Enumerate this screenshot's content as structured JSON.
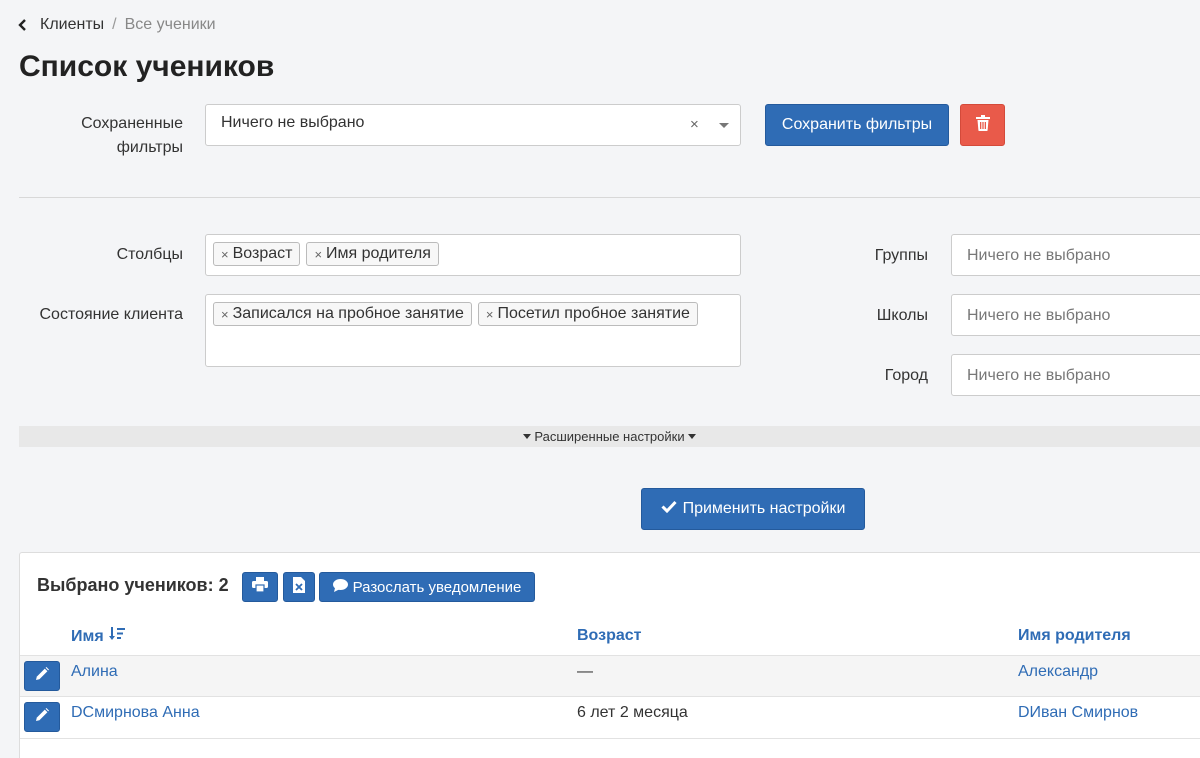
{
  "breadcrumb": {
    "parent": "Клиенты",
    "separator": "/",
    "current": "Все ученики"
  },
  "page_title": "Список учеников",
  "saved_filters": {
    "label_line1": "Сохраненные",
    "label_line2": "фильтры",
    "value": "Ничего не выбрано",
    "clear_symbol": "×",
    "save_button": "Сохранить фильтры"
  },
  "filters": {
    "columns": {
      "label": "Столбцы",
      "tags": [
        "Возраст",
        "Имя родителя"
      ]
    },
    "client_state": {
      "label": "Состояние клиента",
      "tags": [
        "Записался на пробное занятие",
        "Посетил пробное занятие"
      ]
    },
    "groups": {
      "label": "Группы",
      "placeholder": "Ничего не выбрано"
    },
    "schools": {
      "label": "Школы",
      "placeholder": "Ничего не выбрано"
    },
    "city": {
      "label": "Город",
      "placeholder": "Ничего не выбрано"
    },
    "tag_remove_symbol": "×"
  },
  "advanced": {
    "label": "Расширенные настройки"
  },
  "apply_button": "Применить настройки",
  "results": {
    "selected_label": "Выбрано учеников: 2",
    "notify_button": "Разослать уведомление",
    "columns": {
      "name": "Имя",
      "age": "Возраст",
      "parent": "Имя родителя"
    },
    "rows": [
      {
        "name": "Алина",
        "age": "—",
        "parent": "Александр"
      },
      {
        "name": "DСмирнова Анна",
        "age": "6 лет 2 месяца",
        "parent": "DИван Смирнов"
      }
    ]
  },
  "colors": {
    "primary": "#2f6cb5",
    "danger": "#e95a4a",
    "background": "#f4f5f7"
  }
}
